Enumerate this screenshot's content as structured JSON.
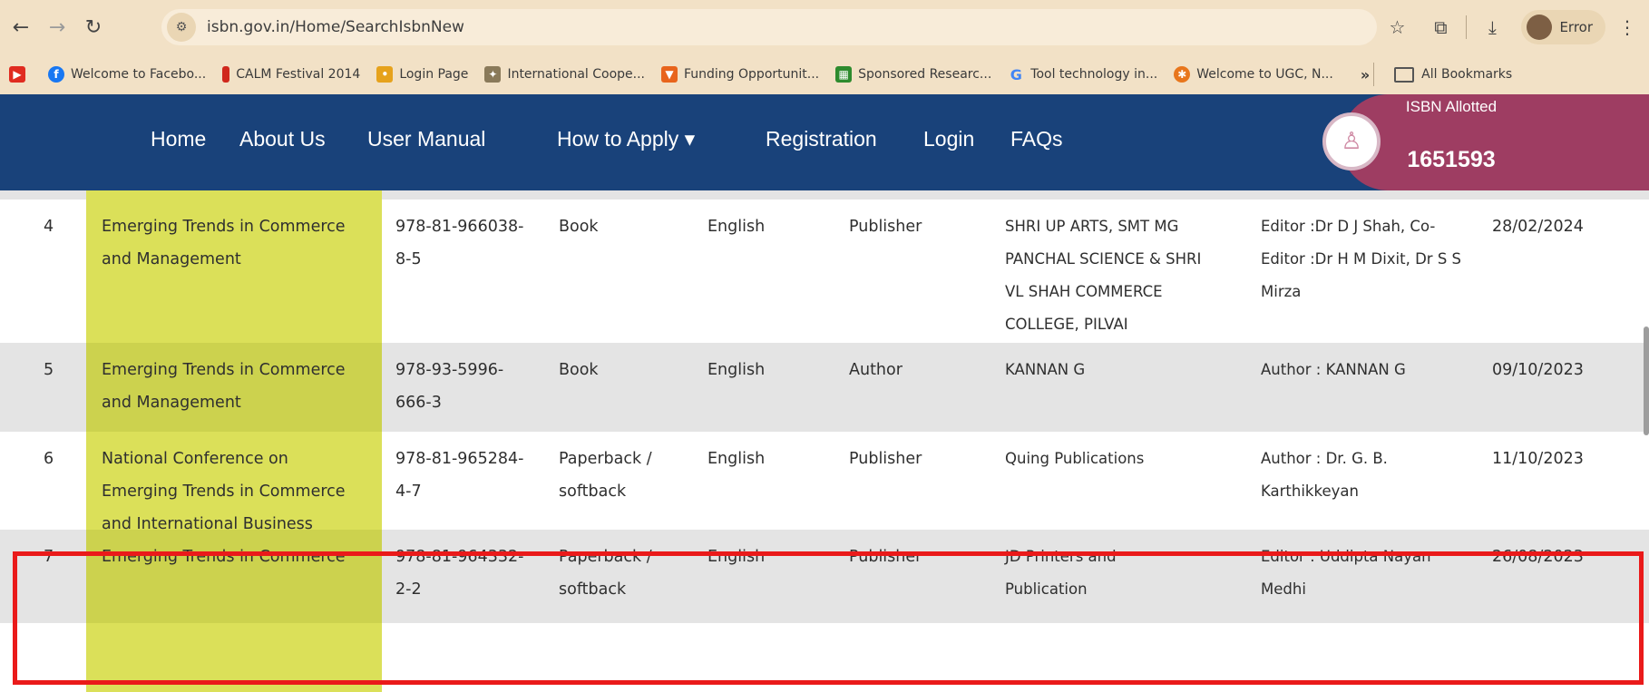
{
  "browser": {
    "url": "isbn.gov.in/Home/SearchIsbnNew",
    "profile_label": "Error",
    "icons": {
      "back": "back-arrow-icon",
      "forward": "forward-arrow-icon",
      "reload": "reload-icon",
      "site_info": "site-info-icon",
      "star": "star-icon",
      "extensions": "puzzle-icon",
      "download": "download-icon",
      "menu": "kebab-menu-icon"
    }
  },
  "bookmarks": {
    "items": [
      {
        "label": "",
        "icon": "youtube-icon",
        "color": "#e02b20"
      },
      {
        "label": "Welcome to Facebo...",
        "icon": "facebook-icon",
        "color": "#1877f2"
      },
      {
        "label": "CALM Festival 2014",
        "icon": "calm-icon",
        "color": "#d0281c"
      },
      {
        "label": "Login Page",
        "icon": "login-page-icon",
        "color": "#e6a21c"
      },
      {
        "label": "International Coope...",
        "icon": "emblem-icon",
        "color": "#8a7a5a"
      },
      {
        "label": "Funding Opportunit...",
        "icon": "shield-icon",
        "color": "#e8641c"
      },
      {
        "label": "Sponsored Researc...",
        "icon": "sponsored-icon",
        "color": "#2e8b2e"
      },
      {
        "label": "Tool technology in...",
        "icon": "google-icon",
        "color": "#4285f4"
      },
      {
        "label": "Welcome to UGC, N...",
        "icon": "ugc-icon",
        "color": "#e8761c"
      }
    ],
    "more": "»",
    "all_bookmarks": "All Bookmarks"
  },
  "site_nav": {
    "links": [
      "Home",
      "About Us",
      "User Manual",
      "How to Apply ▾",
      "Registration",
      "Login",
      "FAQs"
    ],
    "isbn_title": "ISBN Allotted",
    "isbn_count": "1651593",
    "colors": {
      "nav_bg": "#19427a",
      "isbn_bg": "#9e3d62"
    }
  },
  "results": {
    "highlight_color": "#dbe059",
    "rows": [
      {
        "no": "4",
        "title": "Emerging Trends in Commerce\nand Management",
        "isbn": "978-81-966038-\n8-5",
        "type": "Book",
        "language": "English",
        "role": "Publisher",
        "publisher": "SHRI UP ARTS, SMT MG\nPANCHAL SCIENCE & SHRI\nVL SHAH COMMERCE\nCOLLEGE, PILVAI",
        "author": "Editor :Dr D J Shah, Co-\nEditor :Dr H M Dixit, Dr S S\nMirza",
        "date": "28/02/2024"
      },
      {
        "no": "5",
        "title": "Emerging Trends in Commerce\nand Management",
        "isbn": "978-93-5996-\n666-3",
        "type": "Book",
        "language": "English",
        "role": "Author",
        "publisher": "KANNAN G",
        "author": "Author : KANNAN G",
        "date": "09/10/2023"
      },
      {
        "no": "6",
        "title": "National Conference on\nEmerging Trends in Commerce\nand International Business",
        "isbn": "978-81-965284-\n4-7",
        "type": "Paperback /\nsoftback",
        "language": "English",
        "role": "Publisher",
        "publisher": "Quing Publications",
        "author": "Author : Dr. G. B.\nKarthikkeyan",
        "date": "11/10/2023"
      },
      {
        "no": "7",
        "title": "Emerging Trends in Commerce",
        "isbn": "978-81-964332-\n2-2",
        "type": "Paperback /\nsoftback",
        "language": "English",
        "role": "Publisher",
        "publisher": "JD Printers and\nPublication",
        "author": "Editor : Uddipta Nayan\nMedhi",
        "date": "26/08/2023"
      }
    ]
  }
}
